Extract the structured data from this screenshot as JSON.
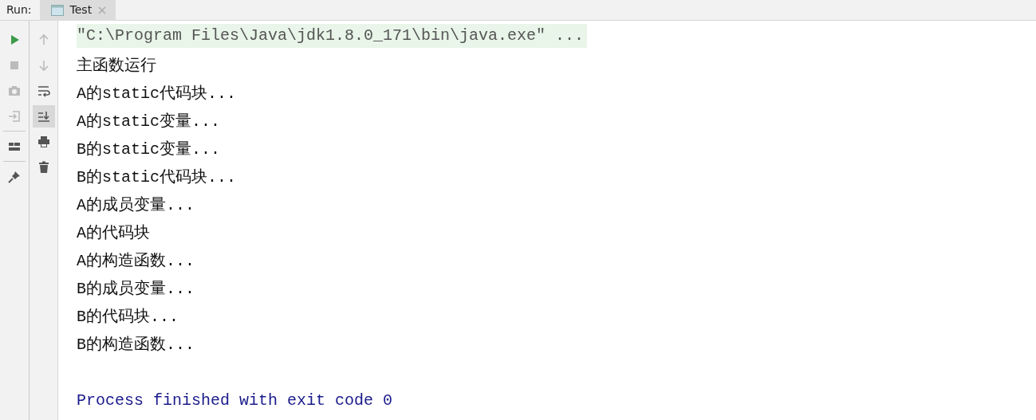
{
  "header": {
    "label": "Run:",
    "tabs": [
      {
        "label": "Test",
        "selected": true,
        "close": "×"
      }
    ]
  },
  "left_toolbar": [
    {
      "kind": "run",
      "disabled": false
    },
    {
      "kind": "stop",
      "disabled": true
    },
    {
      "kind": "camera",
      "disabled": true
    },
    {
      "kind": "enter",
      "disabled": true
    },
    {
      "kind": "sep"
    },
    {
      "kind": "layout",
      "disabled": false
    },
    {
      "kind": "sep"
    },
    {
      "kind": "pin",
      "disabled": false
    }
  ],
  "right_toolbar": [
    {
      "kind": "up",
      "disabled": true,
      "selected": false
    },
    {
      "kind": "down",
      "disabled": true,
      "selected": false
    },
    {
      "kind": "wrap",
      "disabled": false,
      "selected": false
    },
    {
      "kind": "scroll",
      "disabled": false,
      "selected": true
    },
    {
      "kind": "print",
      "disabled": false,
      "selected": false
    },
    {
      "kind": "trash",
      "disabled": false,
      "selected": false
    }
  ],
  "console": [
    {
      "kind": "command",
      "text": "\"C:\\Program Files\\Java\\jdk1.8.0_171\\bin\\java.exe\" ..."
    },
    {
      "kind": "output",
      "text": "主函数运行"
    },
    {
      "kind": "output",
      "text": "A的static代码块..."
    },
    {
      "kind": "output",
      "text": "A的static变量..."
    },
    {
      "kind": "output",
      "text": "B的static变量..."
    },
    {
      "kind": "output",
      "text": "B的static代码块..."
    },
    {
      "kind": "output",
      "text": "A的成员变量..."
    },
    {
      "kind": "output",
      "text": "A的代码块"
    },
    {
      "kind": "output",
      "text": "A的构造函数..."
    },
    {
      "kind": "output",
      "text": "B的成员变量..."
    },
    {
      "kind": "output",
      "text": "B的代码块..."
    },
    {
      "kind": "output",
      "text": "B的构造函数..."
    },
    {
      "kind": "blank"
    },
    {
      "kind": "exit",
      "text": "Process finished with exit code 0"
    }
  ]
}
